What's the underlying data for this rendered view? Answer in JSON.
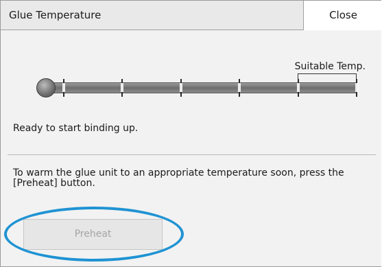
{
  "header": {
    "title": "Glue Temperature",
    "close_label": "Close"
  },
  "temperature_gauge": {
    "zone_label": "Suitable Temp.",
    "level": 0.0
  },
  "status_text": "Ready to start binding up.",
  "instruction_text": "To warm the glue unit to an appropriate temperature soon, press the [Preheat] button.",
  "preheat": {
    "label": "Preheat",
    "enabled": false
  },
  "colors": {
    "highlight": "#1f93d3",
    "panel_bg": "#f2f2f2"
  }
}
